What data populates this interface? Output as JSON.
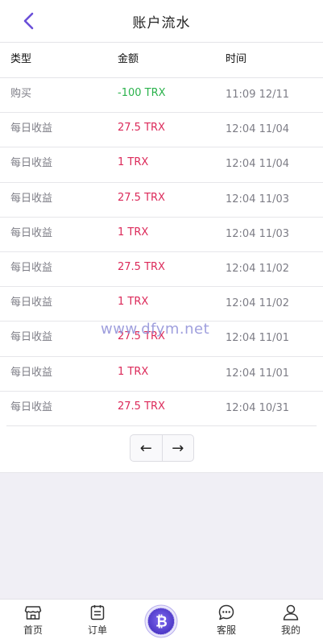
{
  "header": {
    "title": "账户流水"
  },
  "table": {
    "columns": [
      "类型",
      "金额",
      "时间"
    ],
    "rows": [
      {
        "type": "购买",
        "amount": "-100 TRX",
        "time": "11:09 12/11",
        "sign": "neg"
      },
      {
        "type": "每日收益",
        "amount": "27.5 TRX",
        "time": "12:04 11/04",
        "sign": "pos"
      },
      {
        "type": "每日收益",
        "amount": "1 TRX",
        "time": "12:04 11/04",
        "sign": "pos"
      },
      {
        "type": "每日收益",
        "amount": "27.5 TRX",
        "time": "12:04 11/03",
        "sign": "pos"
      },
      {
        "type": "每日收益",
        "amount": "1 TRX",
        "time": "12:04 11/03",
        "sign": "pos"
      },
      {
        "type": "每日收益",
        "amount": "27.5 TRX",
        "time": "12:04 11/02",
        "sign": "pos"
      },
      {
        "type": "每日收益",
        "amount": "1 TRX",
        "time": "12:04 11/02",
        "sign": "pos"
      },
      {
        "type": "每日收益",
        "amount": "27.5 TRX",
        "time": "12:04 11/01",
        "sign": "pos"
      },
      {
        "type": "每日收益",
        "amount": "1 TRX",
        "time": "12:04 11/01",
        "sign": "pos"
      },
      {
        "type": "每日收益",
        "amount": "27.5 TRX",
        "time": "12:04 10/31",
        "sign": "pos"
      }
    ]
  },
  "pager": {
    "prev": "←",
    "next": "→"
  },
  "watermark": "www.dfym.net",
  "tabbar": {
    "home": "首页",
    "order": "订单",
    "service": "客服",
    "mine": "我的"
  },
  "colors": {
    "accent": "#6a4fd8",
    "negative": "#2bb24c",
    "positive": "#dc2a5a",
    "muted": "#7d7d86"
  }
}
